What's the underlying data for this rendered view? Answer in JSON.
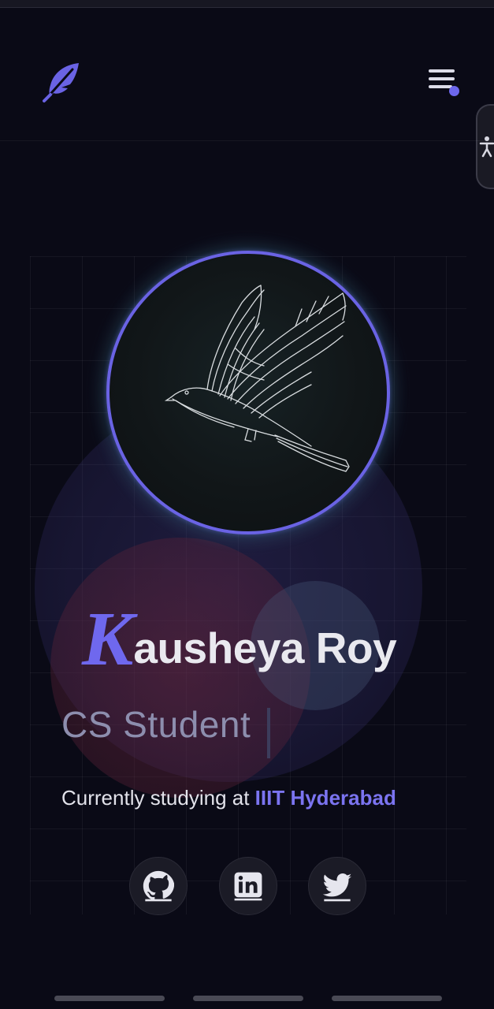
{
  "header": {
    "logo_icon": "feather-icon",
    "menu_icon": "hamburger-menu-icon",
    "accessibility_icon": "accessibility-person-icon"
  },
  "hero": {
    "name_initial": "K",
    "name_rest": "ausheya Roy",
    "role": "CS Student",
    "studying_prefix": "Currently studying at ",
    "institution": "IIIT Hyderabad",
    "avatar_image": "bird line art",
    "accent_color": "#6f68ee"
  },
  "social": [
    {
      "name": "github",
      "icon": "github-icon"
    },
    {
      "name": "linkedin",
      "icon": "linkedin-icon"
    },
    {
      "name": "twitter",
      "icon": "twitter-icon"
    }
  ]
}
